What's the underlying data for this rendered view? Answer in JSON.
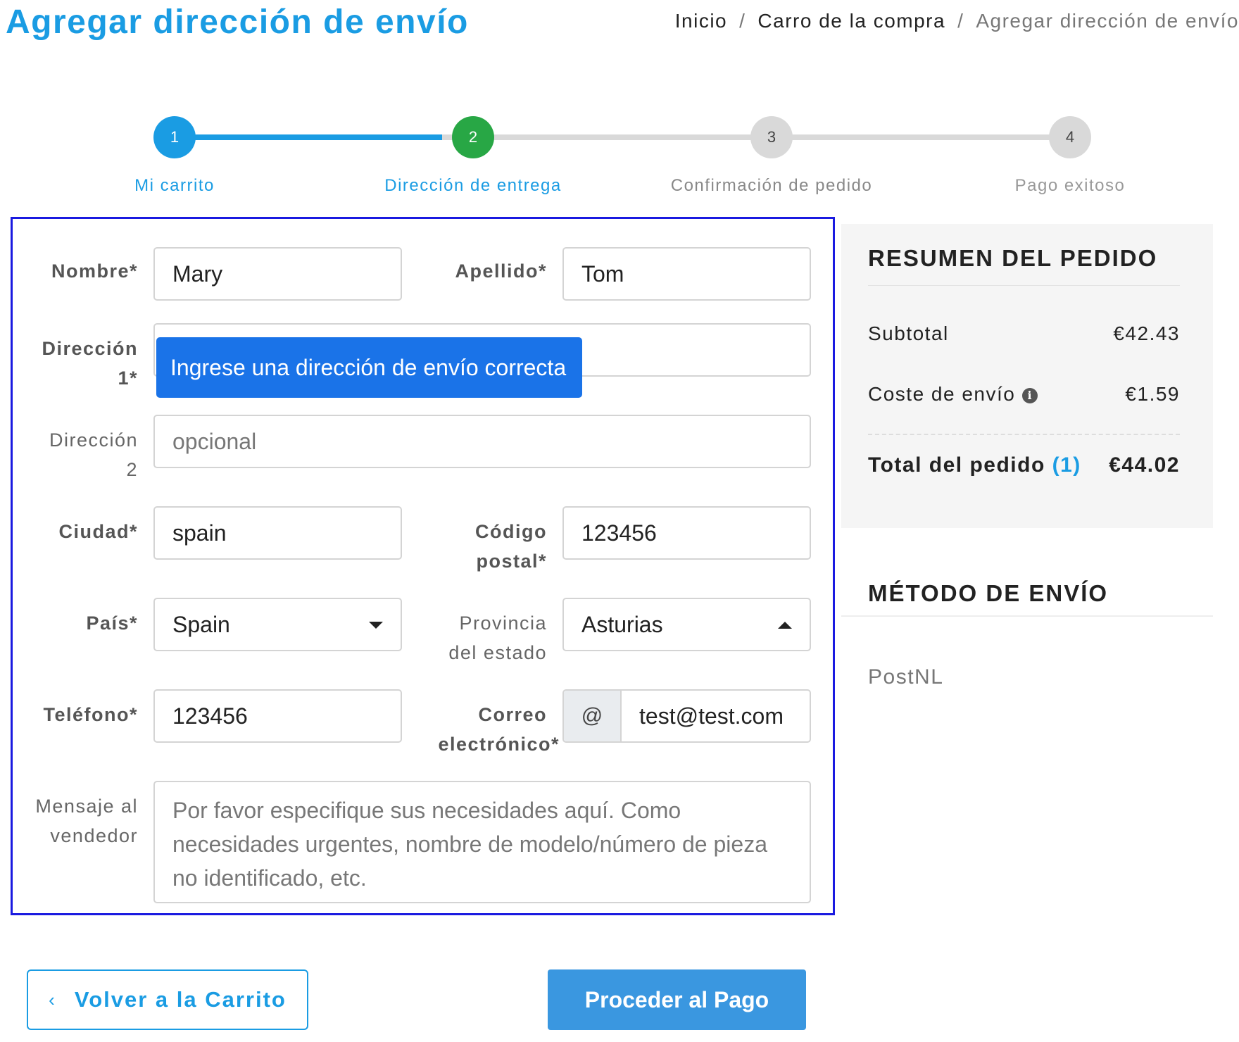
{
  "page_title": "Agregar dirección de envío",
  "breadcrumb": {
    "items": [
      "Inicio",
      "Carro de la compra",
      "Agregar dirección de envío"
    ],
    "separator": "/"
  },
  "stepper": {
    "steps": [
      {
        "number": "1",
        "label": "Mi carrito",
        "state": "complete",
        "color": "#1a9ce3"
      },
      {
        "number": "2",
        "label": "Dirección de entrega",
        "state": "current",
        "color": "#28a745"
      },
      {
        "number": "3",
        "label": "Confirmación de pedido",
        "state": "pending",
        "color": "#d9d9d9"
      },
      {
        "number": "4",
        "label": "Pago exitoso",
        "state": "pending",
        "color": "#d9d9d9"
      }
    ]
  },
  "form": {
    "first_name": {
      "label": "Nombre*",
      "value": "Mary"
    },
    "last_name": {
      "label": "Apellido*",
      "value": "Tom"
    },
    "address1": {
      "label_line1": "Dirección",
      "label_line2": "1*",
      "value": "",
      "tooltip": "Ingrese una dirección de envío correcta"
    },
    "address2": {
      "label_line1": "Dirección",
      "label_line2": "2",
      "placeholder": "opcional"
    },
    "city": {
      "label": "Ciudad*",
      "value": "spain"
    },
    "postal_code": {
      "label_line1": "Código",
      "label_line2": "postal*",
      "value": "123456"
    },
    "country": {
      "label": "País*",
      "value": "Spain"
    },
    "province": {
      "label_line1": "Provincia",
      "label_line2": "del estado",
      "value": "Asturias"
    },
    "phone": {
      "label": "Teléfono*",
      "value": "123456"
    },
    "email": {
      "label_line1": "Correo",
      "label_line2": "electrónico*",
      "prefix": "@",
      "value": "test@test.com"
    },
    "message": {
      "label_line1": "Mensaje al",
      "label_line2": "vendedor",
      "placeholder_lines": [
        "Por favor especifique sus necesidades aquí. Como",
        "necesidades urgentes, nombre de modelo/número de pieza",
        "no identificado, etc."
      ]
    }
  },
  "summary": {
    "title": "RESUMEN DEL PEDIDO",
    "subtotal_label": "Subtotal",
    "subtotal_value": "€42.43",
    "shipping_label": "Coste de envío",
    "shipping_value": "€1.59",
    "total_label": "Total del pedido",
    "total_count": "(1)",
    "total_value": "€44.02"
  },
  "shipping_method": {
    "title": "MÉTODO DE ENVÍO",
    "method": "PostNL"
  },
  "buttons": {
    "back_label": "Volver a la Carrito",
    "pay_label": "Proceder al Pago"
  },
  "colors": {
    "accent": "#1a9ce3",
    "step_current": "#28a745",
    "tooltip_bg": "#1a73e8",
    "form_border": "#1a1ae0",
    "pay_button": "#3a97e0"
  }
}
